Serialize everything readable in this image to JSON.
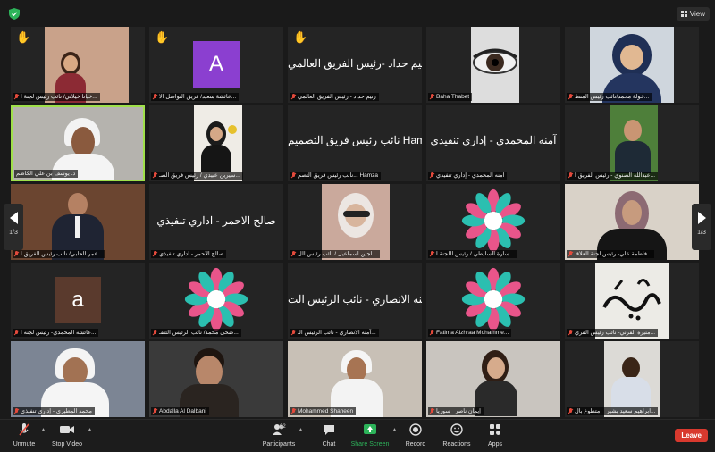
{
  "topbar": {
    "view_label": "View"
  },
  "pager": {
    "left": "1/3",
    "right": "1/3"
  },
  "tiles": [
    {
      "name": "خولة محمد/نائب رئيس المنظ...",
      "type": "photo"
    },
    {
      "name": "Baha Thabet",
      "type": "photo"
    },
    {
      "name": "رنيم حداد - رئيس الفريق العالمي",
      "text": "رنيم حداد -رئيس الفريق العالمي",
      "hand": true
    },
    {
      "name": "عائشة سعيد/ فريق التواصل الا...",
      "letter": "A",
      "hand": true
    },
    {
      "name": "خيانا خيلاني/ نائب رئيس لجنة ا...",
      "type": "photo",
      "hand": true
    },
    {
      "name": "عبدالله الصنوي - رئيس الفريق ا...",
      "type": "photo"
    },
    {
      "name": "آمنه المحمدي - إداري تنفيذي",
      "text": "آمنه المحمدي - إداري تنفيذي"
    },
    {
      "name": "نائب رئيس فريق التصم... Hamza",
      "text": "نائب رئيس فريق التصميم Hamza"
    },
    {
      "name": "سيرين عبيدي / رئيس فريق الصـ...",
      "type": "photo"
    },
    {
      "name": "د. يوسف بن علي الكاظم",
      "type": "photo"
    },
    {
      "name": "فاطمة علي- رئيس لجنة العلاقـ...",
      "type": "photo"
    },
    {
      "name": "سارة السليطي / رئيس اللجنة ا...",
      "type": "flower"
    },
    {
      "name": "لجين اسماعيل / نائب رئيس الل...",
      "type": "photo"
    },
    {
      "name": "صالح الاحمر - اداري تنفيذي",
      "text": "صالح الاحمر - اداري تنفيذي"
    },
    {
      "name": "عمر الحلبي/ نائب رئيس الفريق ا...",
      "type": "photo"
    },
    {
      "name": "منيرة القرني- نائب رئيس الفري...",
      "type": "calligraphy"
    },
    {
      "name": "Fatima Alzhraa Mohamme...",
      "type": "flower"
    },
    {
      "name": "آمنه الانصاري - نائب الرئيس الـ...",
      "text": "آمنه الانصاري - نائب الرئيس الت..."
    },
    {
      "name": "ضحى محمد/ نائب الرئيس التنفـ...",
      "type": "flower"
    },
    {
      "name": "عائشة المحمدي- رئيس لجنة ا...",
      "letter": "a"
    },
    {
      "name": "ابراهيم سعيد بشير _ متطوع بال...",
      "type": "photo"
    },
    {
      "name": "إيمان ناصر_ سوريا",
      "type": "photo"
    },
    {
      "name": "Mohammed Shaheen",
      "type": "photo"
    },
    {
      "name": "Abdalla Al Dalbani",
      "type": "photo"
    },
    {
      "name": "محمد المطيري - إداري تنفيذي",
      "type": "photo"
    }
  ],
  "toolbar": {
    "unmute": "Unmute",
    "stop_video": "Stop Video",
    "participants": "Participants",
    "participants_count": "62",
    "chat": "Chat",
    "share_screen": "Share Screen",
    "record": "Record",
    "reactions": "Reactions",
    "apps": "Apps",
    "leave": "Leave"
  },
  "colors": {
    "active_speaker": "#9fe04a",
    "share_green": "#2db35a",
    "leave_red": "#d8392e",
    "flower_pink": "#e9558a",
    "flower_teal": "#2bbfb0"
  }
}
